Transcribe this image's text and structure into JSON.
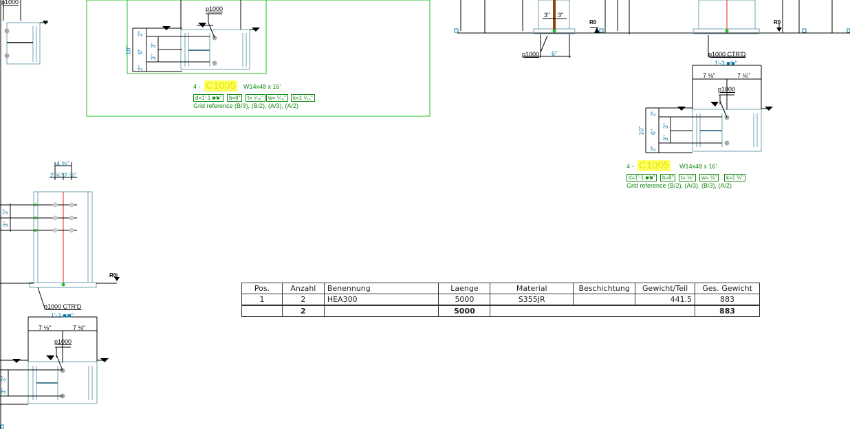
{
  "colors": {
    "line": "#000000",
    "steel": "#6fa0b0",
    "frame": "#20c020",
    "center_line": "#e02020",
    "weld": "#8b4513",
    "dim_text": "#0b7fa6",
    "note_text": "#138a13",
    "highlight": "#ffff66"
  },
  "detail_top_left": {
    "p_label": "p1000",
    "dims": [
      "2\"",
      "3\"",
      "6\"",
      "3\"",
      "2\""
    ],
    "total": "10\"",
    "count": "4 -",
    "mark": "C1005",
    "section": "W14x48 x 16'",
    "props": [
      "d=1'-1 ■⁄■\"",
      "b=8\"",
      "t= ⁵⁄₁₆\"",
      "w= ⁵⁄₁₆\"",
      "k=1 ⁵⁄₁₆\""
    ],
    "grid_ref": "Grid reference (B/3), (B/2), (A/3), (A/2)"
  },
  "detail_right": {
    "p_label": "p1000 CTR'D",
    "span": "1'-3 ■⁄■\"",
    "half_left": "7 ⅛\"",
    "half_right": "7 ⅛\"",
    "p_label2": "p1000",
    "dims": [
      "2\"",
      "3\"",
      "6\"",
      "3\"",
      "2\""
    ],
    "total": "10\"",
    "count": "4 -",
    "mark": "C1005",
    "section": "W14x48 x 16'",
    "props": [
      "d=1'-1 ■⁄■\"",
      "b=8\"",
      "t= ⅛\"",
      "w= ⅛\"",
      "k=1 ⅛\""
    ],
    "grid_ref": "Grid reference (B/2), (A/3), (B/3), (A/2)"
  },
  "detail_top_center": {
    "weld_dims": [
      "3\"",
      "3\""
    ],
    "p_label": "p1000",
    "base_dim": "6\""
  },
  "detail_left_mid": {
    "top_dim": "4 ⅝\"",
    "half_dims": [
      "2 ⅝\"",
      "2 ⅝\""
    ],
    "row_dims": [
      "3\"",
      "3\""
    ]
  },
  "detail_bottom_left": {
    "p_label": "p1000 CTR'D",
    "span": "1'-3 ■⁄■\"",
    "half_left": "7 ⅛\"",
    "half_right": "7 ⅛\"",
    "p_label2": "p1000",
    "row_dims": [
      "3\"",
      "3\""
    ]
  },
  "corner_label": "p1000",
  "markers": [
    "R0",
    "R0",
    "R0"
  ],
  "parts_list": {
    "headers": [
      "Pos.",
      "Anzahl",
      "Benennung",
      "Laenge",
      "Material",
      "Beschichtung",
      "Gewicht/Teil",
      "Ges. Gewicht"
    ],
    "rows": [
      [
        "1",
        "2",
        "HEA300",
        "5000",
        "S355JR",
        "",
        "441.5",
        "883"
      ]
    ],
    "total": [
      "",
      "2",
      "",
      "5000",
      "",
      "",
      "",
      "883"
    ]
  }
}
